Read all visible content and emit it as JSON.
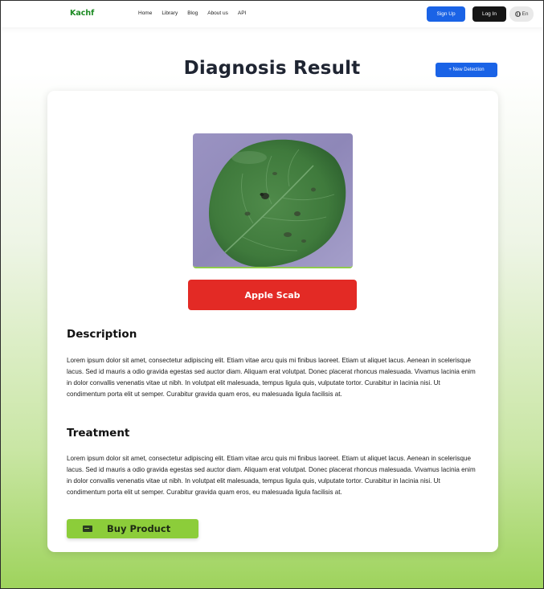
{
  "nav": {
    "logo": "Kachf",
    "links": [
      "Home",
      "Library",
      "Blog",
      "About us",
      "API"
    ],
    "signup_label": "Sign Up",
    "login_label": "Log In",
    "lang_label": "En"
  },
  "header": {
    "title": "Diagnosis Result",
    "new_detection_label": "+ New Detection"
  },
  "result": {
    "disease_label": "Apple Scab",
    "image_alt": "leaf-photo"
  },
  "description": {
    "heading": "Description",
    "text": "Lorem ipsum dolor sit amet, consectetur adipiscing elit. Etiam vitae arcu quis mi finibus laoreet. Etiam ut aliquet lacus. Aenean in scelerisque lacus. Sed id mauris a odio gravida egestas sed auctor diam. Aliquam erat volutpat. Donec placerat rhoncus malesuada. Vivamus lacinia enim in dolor convallis venenatis vitae ut nibh. In volutpat elit malesuada, tempus ligula quis, vulputate tortor. Curabitur in lacinia nisi. Ut condimentum porta elit ut semper. Curabitur gravida quam eros, eu malesuada ligula facilisis at."
  },
  "treatment": {
    "heading": "Treatment",
    "text": "Lorem ipsum dolor sit amet, consectetur adipiscing elit. Etiam vitae arcu quis mi finibus laoreet. Etiam ut aliquet lacus. Aenean in scelerisque lacus. Sed id mauris a odio gravida egestas sed auctor diam. Aliquam erat volutpat. Donec placerat rhoncus malesuada. Vivamus lacinia enim in dolor convallis venenatis vitae ut nibh. In volutpat elit malesuada, tempus ligula quis, vulputate tortor. Curabitur in lacinia nisi. Ut condimentum porta elit ut semper. Curabitur gravida quam eros, eu malesuada ligula facilisis at."
  },
  "actions": {
    "buy_label": "Buy Product",
    "buy_icon": "credit-card-icon"
  },
  "colors": {
    "brand_green": "#1b8a22",
    "primary_blue": "#1a63e6",
    "danger_red": "#e32a25",
    "buy_green": "#8ccd3a"
  }
}
